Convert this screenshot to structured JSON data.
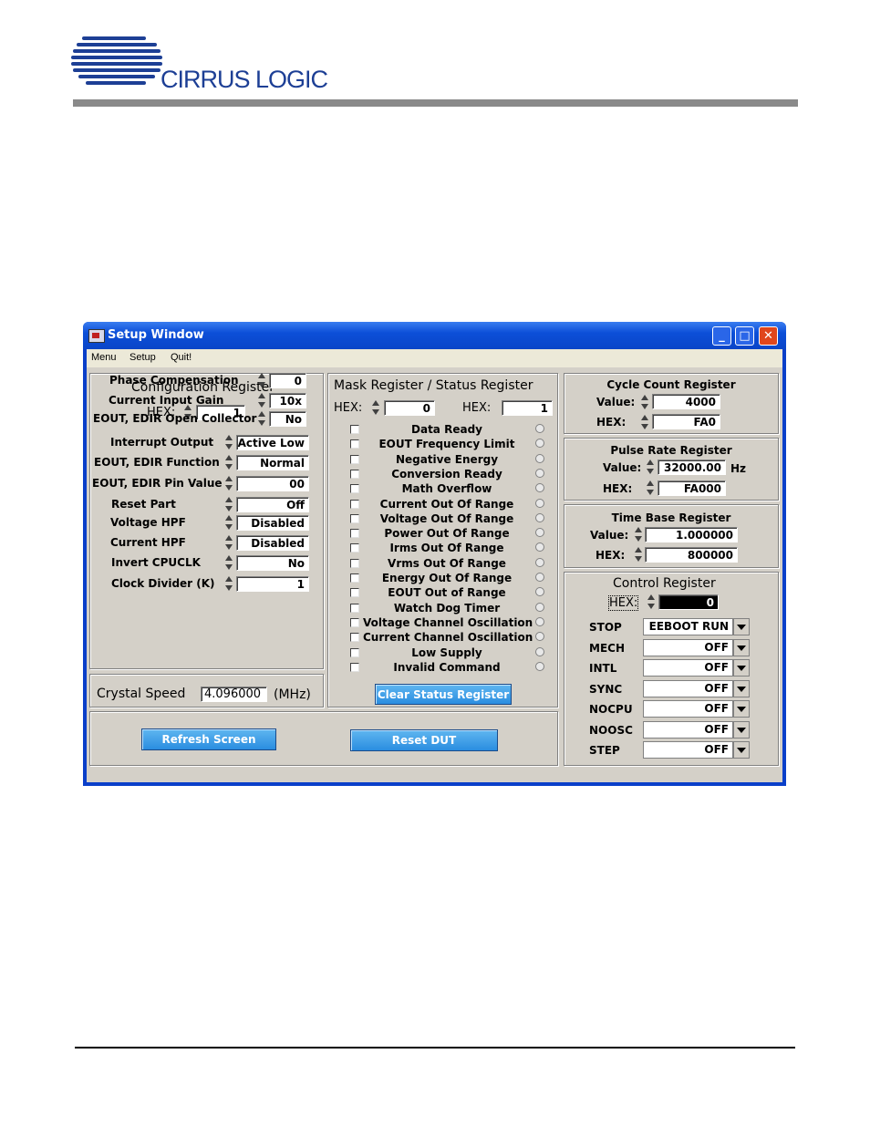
{
  "header": {
    "brand": "CIRRUS LOGIC"
  },
  "window": {
    "title": "Setup Window",
    "controls": {
      "minimize": "_",
      "maximize": "□",
      "close": "✕"
    },
    "menu": [
      "Menu",
      "Setup",
      "Quit!"
    ]
  },
  "config": {
    "title": "Configuration Register",
    "hex_label": "HEX:",
    "hex": "1",
    "rows": [
      {
        "label": "Phase Compensation",
        "value": "0"
      },
      {
        "label": "Current Input Gain",
        "value": "10x"
      },
      {
        "label": "EOUT, EDIR Open Collector",
        "value": "No"
      },
      {
        "label": "Interrupt Output",
        "value": "Active Low"
      },
      {
        "label": "EOUT, EDIR Function",
        "value": "Normal"
      },
      {
        "label": "EOUT, EDIR Pin Value",
        "value": "00"
      },
      {
        "label": "Reset Part",
        "value": "Off"
      },
      {
        "label": "Voltage HPF",
        "value": "Disabled"
      },
      {
        "label": "Current HPF",
        "value": "Disabled"
      },
      {
        "label": "Invert CPUCLK",
        "value": "No"
      },
      {
        "label": "Clock Divider (K)",
        "value": "1"
      }
    ]
  },
  "crystal": {
    "label": "Crystal Speed",
    "value": "4.096000",
    "unit": "(MHz)"
  },
  "mask": {
    "title": "Mask Register / Status Register",
    "hex_label": "HEX:",
    "mask_hex": "0",
    "status_hex": "1",
    "items": [
      "Data Ready",
      "EOUT Frequency Limit",
      "Negative Energy",
      "Conversion Ready",
      "Math Overflow",
      "Current Out Of Range",
      "Voltage Out Of Range",
      "Power Out Of Range",
      "Irms Out Of Range",
      "Vrms Out Of Range",
      "Energy Out Of Range",
      "EOUT Out of Range",
      "Watch Dog Timer",
      "Voltage Channel Oscillation",
      "Current Channel Oscillation",
      "Low Supply",
      "Invalid Command"
    ],
    "clear_button": "Clear Status Register"
  },
  "cycle": {
    "title": "Cycle Count Register",
    "value_label": "Value:",
    "value": "4000",
    "hex_label": "HEX:",
    "hex": "FA0"
  },
  "pulse": {
    "title": "Pulse Rate Register",
    "value_label": "Value:",
    "value": "32000.00",
    "unit": "Hz",
    "hex_label": "HEX:",
    "hex": "FA000"
  },
  "timebase": {
    "title": "Time Base Register",
    "value_label": "Value:",
    "value": "1.000000",
    "hex_label": "HEX:",
    "hex": "800000"
  },
  "control": {
    "title": "Control Register",
    "hex_label": "HEX:",
    "hex": "0",
    "rows": [
      {
        "label": "STOP",
        "value": "EEBOOT RUN"
      },
      {
        "label": "MECH",
        "value": "OFF"
      },
      {
        "label": "INTL",
        "value": "OFF"
      },
      {
        "label": "SYNC",
        "value": "OFF"
      },
      {
        "label": "NOCPU",
        "value": "OFF"
      },
      {
        "label": "NOOSC",
        "value": "OFF"
      },
      {
        "label": "STEP",
        "value": "OFF"
      }
    ]
  },
  "buttons": {
    "refresh": "Refresh Screen",
    "reset": "Reset DUT"
  },
  "colors": {
    "title_bar": "#0a45c8",
    "face": "#d4d0c8",
    "button": "#2a8de0"
  }
}
